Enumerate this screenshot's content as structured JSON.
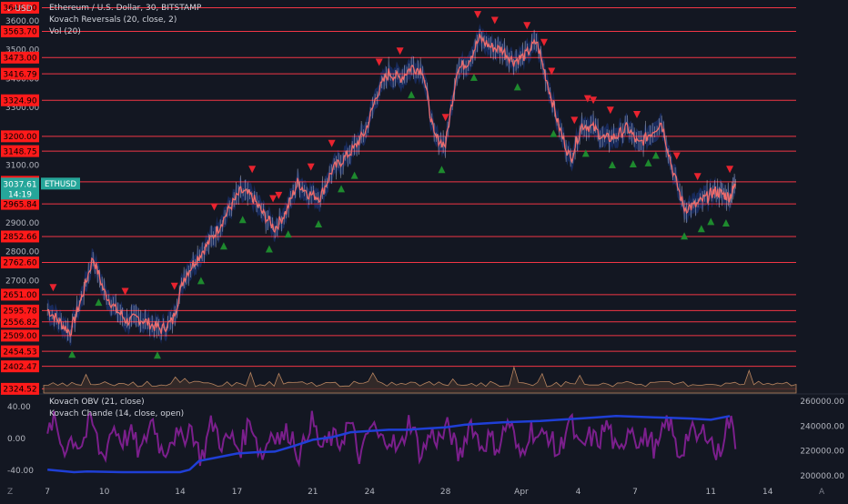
{
  "header": {
    "currency": "USD",
    "title": "Ethereum / U.S. Dollar, 30, BITSTAMP",
    "indicator1": "Kovach Reversals (20, close, 2)",
    "indicator2": "Vol (20)",
    "osc1": "Kovach OBV (21, close)",
    "osc2": "Kovach Chande (14, close, open)"
  },
  "current_price": {
    "symbol": "ETHUSD",
    "price": "3037.61",
    "countdown": "14:19"
  },
  "corner": {
    "left_label": "Z",
    "right_label": "A"
  },
  "colors": {
    "background": "#131722",
    "level_line": "#f23645",
    "level_label_bg": "#ff1a1a",
    "price_line": "#ef6b6b",
    "band": "#1e3a8a",
    "up_marker": "#1e8a2e",
    "down_marker": "#e8232f",
    "obv": "#1f3fd6",
    "chande": "#7b1f8c",
    "current_price_bg": "#26a69a",
    "volume_line": "#e0a070"
  },
  "chart_data": [
    {
      "type": "line",
      "title": "Ethereum / U.S. Dollar, 30, BITSTAMP",
      "y_ticks": [
        "3600.00",
        "3500.00",
        "3400.00",
        "3300.00",
        "3100.00",
        "3000.00",
        "2900.00",
        "2800.00",
        "2700.00"
      ],
      "ylim": [
        2310,
        3660
      ],
      "levels": [
        "3646.00",
        "3563.70",
        "3473.00",
        "3416.79",
        "3324.90",
        "3200.00",
        "3148.75",
        "3042.18",
        "2965.84",
        "2852.66",
        "2762.60",
        "2651.00",
        "2595.78",
        "2556.82",
        "2509.00",
        "2454.53",
        "2402.47",
        "2324.52"
      ],
      "x_ticks": [
        "7",
        "10",
        "14",
        "17",
        "21",
        "24",
        "28",
        "Apr",
        "4",
        "7",
        "11",
        "14"
      ],
      "x_tick_days": [
        0,
        3,
        7,
        10,
        14,
        17,
        21,
        25,
        28,
        31,
        35,
        38
      ],
      "xlim": [
        -0.2,
        39.5
      ],
      "series": [
        {
          "values_x": [
            0,
            0.6,
            1.2,
            1.8,
            2.4,
            3.0,
            3.6,
            4.2,
            4.8,
            5.4,
            6.0,
            6.6,
            7.2,
            7.8,
            8.4,
            9.0,
            9.6,
            10.2,
            10.8,
            11.4,
            12.0,
            12.6,
            13.2,
            13.8,
            14.4,
            15.0,
            15.6,
            16.2,
            16.8,
            17.4,
            18.0,
            18.6,
            19.2,
            19.8,
            20.4,
            21.0,
            21.6,
            22.2,
            22.8,
            23.4,
            24.0,
            24.6,
            25.2,
            25.8,
            26.4,
            27.0,
            27.6,
            28.2,
            28.8,
            29.4,
            30.0,
            30.6,
            31.2,
            31.8,
            32.4,
            33.0,
            33.6,
            34.2,
            34.8,
            35.2,
            35.6,
            36.0,
            36.3
          ],
          "values_y": [
            2600,
            2560,
            2520,
            2640,
            2780,
            2660,
            2600,
            2560,
            2570,
            2550,
            2530,
            2560,
            2710,
            2770,
            2820,
            2880,
            2950,
            3010,
            2990,
            2930,
            2880,
            2940,
            3040,
            3000,
            2990,
            3080,
            3120,
            3160,
            3220,
            3350,
            3420,
            3400,
            3440,
            3430,
            3200,
            3170,
            3430,
            3460,
            3540,
            3510,
            3500,
            3460,
            3480,
            3530,
            3380,
            3230,
            3120,
            3240,
            3230,
            3190,
            3200,
            3230,
            3170,
            3210,
            3250,
            3080,
            2950,
            2960,
            2990,
            3010,
            3000,
            2990,
            3035
          ]
        }
      ],
      "up_marker_x": [
        1.3,
        2.7,
        5.8,
        8.1,
        9.3,
        10.3,
        11.7,
        12.7,
        14.3,
        15.5,
        16.2,
        19.2,
        20.8,
        22.5,
        24.8,
        26.7,
        28.4,
        29.8,
        30.9,
        31.7,
        32.1,
        33.6,
        34.5,
        35.0,
        35.8
      ],
      "down_marker_x": [
        0.3,
        4.1,
        6.7,
        8.8,
        10.8,
        11.9,
        12.2,
        13.9,
        15.0,
        17.5,
        18.6,
        21.0,
        22.7,
        23.6,
        25.3,
        26.2,
        26.6,
        27.8,
        28.5,
        28.8,
        29.7,
        31.1,
        33.2,
        34.3,
        36.0
      ]
    },
    {
      "type": "line",
      "title": "Kovach OBV (21, close)",
      "right_ticks": [
        "260000.00",
        "240000.00",
        "220000.00",
        "200000.00"
      ],
      "values_x": [
        0,
        1.4,
        2.1,
        4,
        6,
        7,
        7.5,
        8,
        9,
        10,
        11,
        12,
        13,
        14,
        15,
        16,
        17,
        18,
        19,
        20,
        21,
        22,
        23,
        24,
        25,
        26,
        27,
        28,
        29,
        30,
        31,
        32,
        33,
        34,
        35,
        36
      ],
      "values_y": [
        205000,
        203000,
        203500,
        203000,
        203000,
        203000,
        205000,
        212000,
        215000,
        218000,
        219000,
        219500,
        224000,
        229000,
        231000,
        235000,
        236000,
        237000,
        237000,
        238000,
        239000,
        241000,
        242000,
        243000,
        243500,
        244000,
        245000,
        246000,
        247000,
        248000,
        247500,
        247000,
        246500,
        246000,
        245000,
        248000
      ]
    },
    {
      "type": "line",
      "title": "Kovach Chande (14, close, open)",
      "y_ticks": [
        "40.00",
        "0.00",
        "-40.00"
      ],
      "ylim": [
        -55,
        55
      ]
    }
  ]
}
